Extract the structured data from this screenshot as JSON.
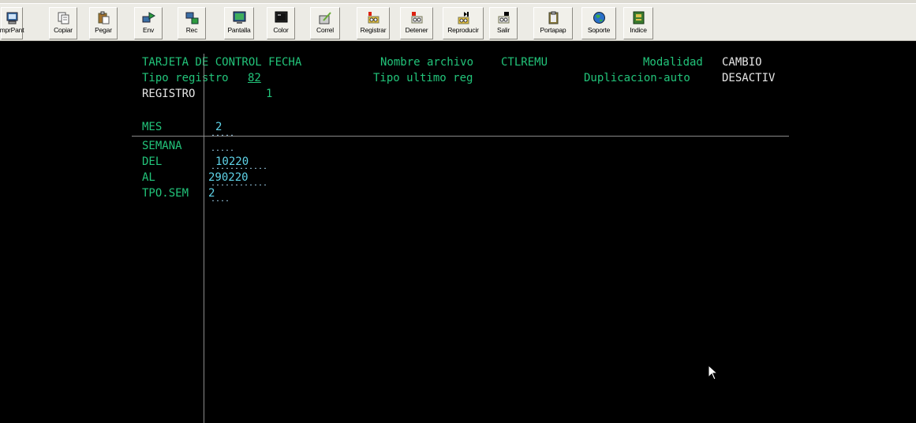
{
  "toolbar": {
    "buttons": [
      {
        "label": "mprPant",
        "icon": "print-screen-icon"
      },
      {
        "label": "Copiar",
        "icon": "copy-icon"
      },
      {
        "label": "Pegar",
        "icon": "paste-icon"
      },
      {
        "label": "Env",
        "icon": "send-icon"
      },
      {
        "label": "Rec",
        "icon": "receive-icon"
      },
      {
        "label": "Pantalla",
        "icon": "screen-icon"
      },
      {
        "label": "Color",
        "icon": "color-icon"
      },
      {
        "label": "Correl",
        "icon": "correlation-icon"
      },
      {
        "label": "Registrar",
        "icon": "record-icon"
      },
      {
        "label": "Detener",
        "icon": "stop-icon"
      },
      {
        "label": "Reproducir",
        "icon": "play-icon"
      },
      {
        "label": "Salir",
        "icon": "exit-icon"
      },
      {
        "label": "Portapap",
        "icon": "clipboard-icon"
      },
      {
        "label": "Soporte",
        "icon": "support-globe-icon"
      },
      {
        "label": "Indice",
        "icon": "index-book-icon"
      }
    ]
  },
  "screen": {
    "title": "TARJETA DE CONTROL FECHA",
    "file_label": "Nombre archivo",
    "file_value": "CTLREMU",
    "mode_label": "Modalidad",
    "mode_value": "CAMBIO",
    "record_type_label": "Tipo registro",
    "record_type_value": "82",
    "last_type_label": "Tipo ultimo reg",
    "dup_label": "Duplicacion-auto",
    "dup_value": "DESACTIV",
    "record_label": "REGISTRO",
    "record_value": "1",
    "fields": [
      {
        "label": "MES",
        "value": "2"
      },
      {
        "label": "SEMANA",
        "value": ""
      },
      {
        "label": "DEL",
        "value": "10220"
      },
      {
        "label": "AL",
        "value": "290220"
      },
      {
        "label": "TPO.SEM",
        "value": "2"
      }
    ]
  },
  "colors": {
    "label_green": "#22c47a",
    "value_cyan": "#5fd3e8",
    "value_white": "#e6e6e6",
    "background": "#000000"
  }
}
